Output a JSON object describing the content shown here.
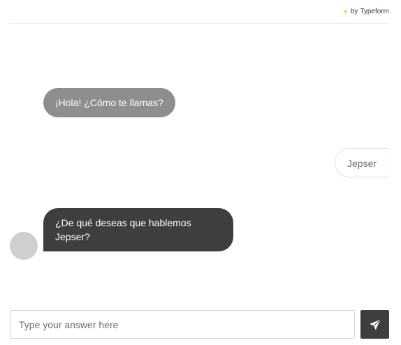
{
  "header": {
    "brand_prefix": "by",
    "brand_name": "Typeform",
    "brand_icon": "lightning-bolt-icon"
  },
  "chat": {
    "messages": [
      {
        "from": "bot",
        "text": "¡Hola! ¿Cómo te llamas?"
      },
      {
        "from": "user",
        "text": "Jepser"
      },
      {
        "from": "bot",
        "text": "¿De qué deseas que hablemos Jepser?"
      }
    ]
  },
  "composer": {
    "placeholder": "Type your answer here",
    "value": "",
    "send_icon": "paper-plane-icon"
  },
  "colors": {
    "bot_bubble_first": "#8e8e8e",
    "bot_bubble_latest": "#3e3e3e",
    "send_button": "#3e3e3e",
    "bolt": "#f2b705"
  }
}
